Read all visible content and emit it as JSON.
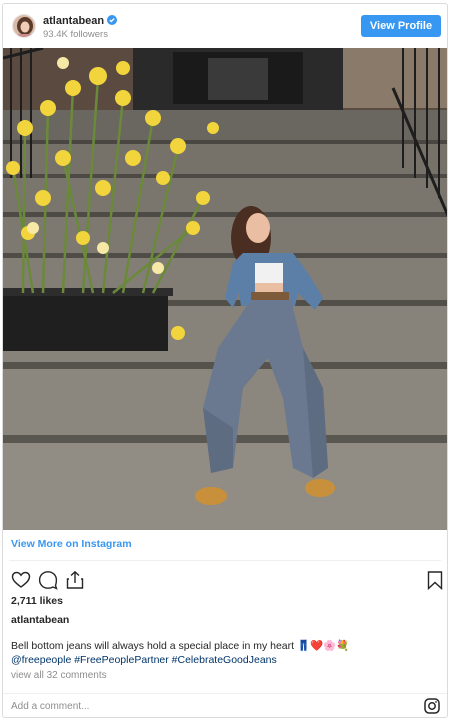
{
  "header": {
    "username": "atlantabean",
    "followers": "93.4K followers",
    "view_profile_label": "View Profile"
  },
  "post": {
    "view_more_label": "View More on Instagram",
    "likes": "2,711 likes",
    "caption_user": "atlantabean",
    "caption_text": "Bell bottom jeans will always hold a special place in my heart 👖❤️🌸💐",
    "hashtags": "@freepeople #FreePeoplePartner #CelebrateGoodJeans",
    "view_comments": "view all 32 comments",
    "add_comment_placeholder": "Add a comment..."
  },
  "icons": [
    "verified-badge-icon",
    "heart-icon",
    "comment-icon",
    "share-icon",
    "bookmark-icon",
    "instagram-icon"
  ],
  "colors": {
    "accent": "#3897f0",
    "hashtag": "#003569",
    "muted": "#8e8e8e",
    "text": "#262626"
  }
}
